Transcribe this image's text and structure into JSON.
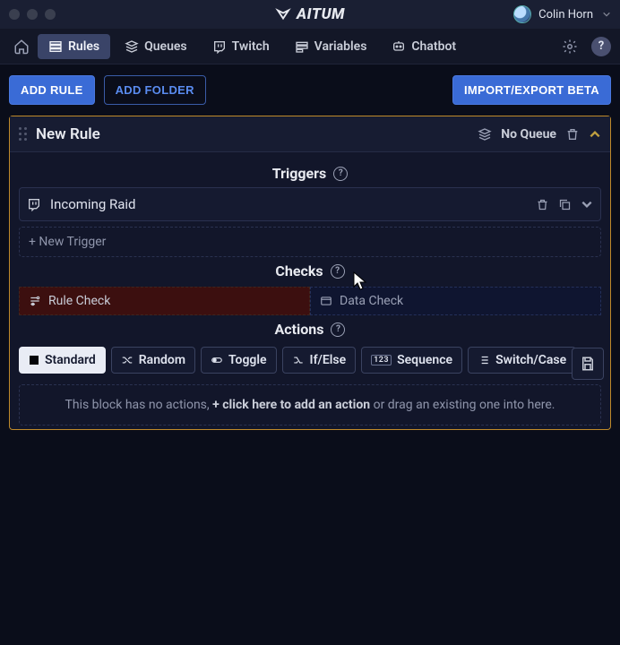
{
  "app": {
    "name": "AITUM"
  },
  "user": {
    "name": "Colin Horn"
  },
  "nav": {
    "tabs": [
      {
        "label": "Rules"
      },
      {
        "label": "Queues"
      },
      {
        "label": "Twitch"
      },
      {
        "label": "Variables"
      },
      {
        "label": "Chatbot"
      }
    ]
  },
  "buttons": {
    "add_rule": "ADD RULE",
    "add_folder": "ADD FOLDER",
    "import_export": "IMPORT/EXPORT BETA"
  },
  "rule": {
    "title": "New Rule",
    "queue": "No Queue"
  },
  "sections": {
    "triggers": "Triggers",
    "checks": "Checks",
    "actions": "Actions"
  },
  "triggers": {
    "items": [
      {
        "label": "Incoming Raid"
      }
    ],
    "add": "+ New Trigger"
  },
  "checks": {
    "rule": "Rule Check",
    "data": "Data Check"
  },
  "action_tabs": [
    {
      "label": "Standard"
    },
    {
      "label": "Random"
    },
    {
      "label": "Toggle"
    },
    {
      "label": "If/Else"
    },
    {
      "label": "Sequence"
    },
    {
      "label": "Switch/Case"
    }
  ],
  "empty": {
    "pre": "This block has no actions, ",
    "link": "+ click here to add an action",
    "post": " or drag an existing one into here."
  }
}
